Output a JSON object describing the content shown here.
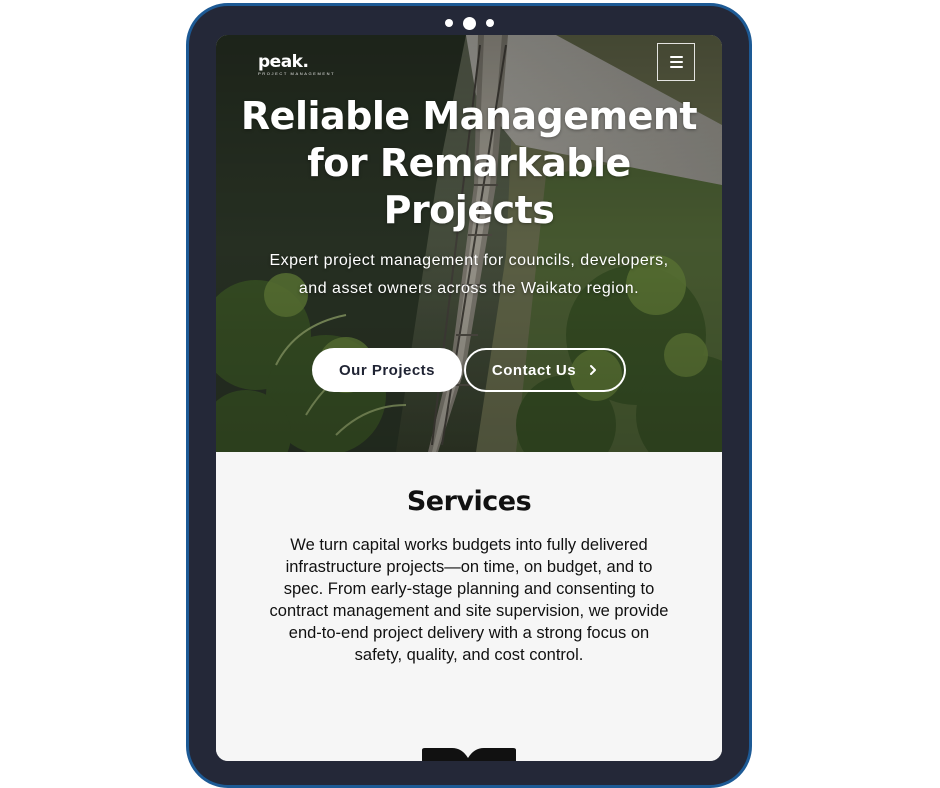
{
  "brand": {
    "logo_word": "peak.",
    "logo_subtitle": "PROJECT MANAGEMENT"
  },
  "header": {
    "menu_icon": "hamburger-menu-icon"
  },
  "hero": {
    "title_lines": [
      "Reliable Management",
      "for Remarkable",
      "Projects"
    ],
    "subtitle_lines": [
      "Expert project management for councils, developers,",
      "and asset owners across the Waikato region."
    ],
    "primary_button": "Our Projects",
    "secondary_button": "Contact Us",
    "secondary_button_icon": "chevron-right-icon"
  },
  "services": {
    "title": "Services",
    "body_lines": [
      "We turn capital works budgets into fully delivered",
      "infrastructure projects—on time, on budget, and to",
      "spec. From early-stage planning and consenting to",
      "contract management and site supervision, we provide",
      "end-to-end project delivery with a strong focus on",
      "safety, quality, and cost control."
    ]
  },
  "colors": {
    "frame": "#242838",
    "frame_border": "#1d5a95",
    "button_text": "#1f2333",
    "section_bg": "#f6f6f6"
  }
}
